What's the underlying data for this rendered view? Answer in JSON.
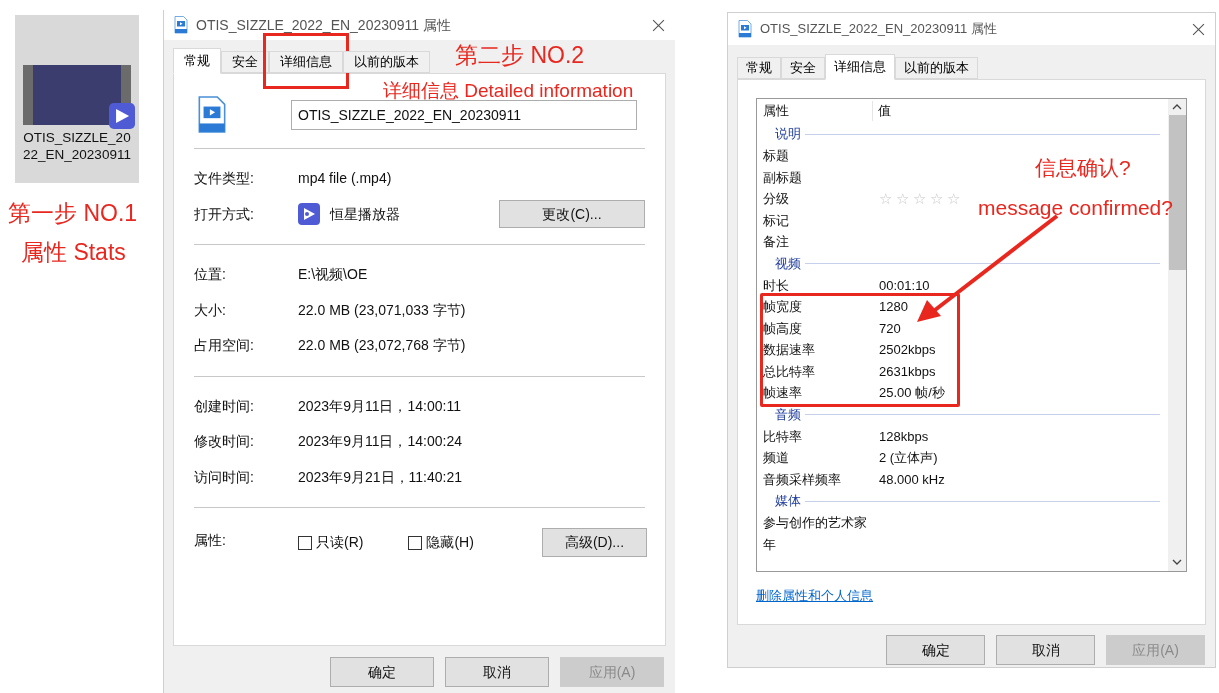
{
  "file_tile": {
    "name": "OTIS_SIZZLE_2022_EN_20230911"
  },
  "annotations": [
    {
      "text": "第一步 NO.1"
    },
    {
      "text": "属性 Stats"
    },
    {
      "text": "第二步 NO.2"
    },
    {
      "text": "详细信息 Detailed information"
    },
    {
      "text": "信息确认?"
    },
    {
      "text": "message confirmed?"
    }
  ],
  "general_dialog": {
    "title": "OTIS_SIZZLE_2022_EN_20230911 属性",
    "tabs": [
      {
        "label": "常规",
        "selected": true,
        "highlighted": false
      },
      {
        "label": "安全",
        "selected": false,
        "highlighted": false
      },
      {
        "label": "详细信息",
        "selected": false,
        "highlighted": true
      },
      {
        "label": "以前的版本",
        "selected": false,
        "highlighted": false
      }
    ],
    "filename": "OTIS_SIZZLE_2022_EN_20230911",
    "groups": [
      {
        "rows": [
          {
            "kind": "text",
            "label": "文件类型:",
            "value": "mp4 file (.mp4)"
          },
          {
            "kind": "app",
            "label": "打开方式:",
            "value": "恒星播放器",
            "button": "更改(C)..."
          }
        ]
      },
      {
        "rows": [
          {
            "kind": "text",
            "label": "位置:",
            "value": "E:\\视频\\OE"
          },
          {
            "kind": "text",
            "label": "大小:",
            "value": "22.0 MB (23,071,033 字节)"
          },
          {
            "kind": "text",
            "label": "占用空间:",
            "value": "22.0 MB (23,072,768 字节)"
          }
        ]
      },
      {
        "rows": [
          {
            "kind": "text",
            "label": "创建时间:",
            "value": "2023年9月11日，14:00:11"
          },
          {
            "kind": "text",
            "label": "修改时间:",
            "value": "2023年9月11日，14:00:24"
          },
          {
            "kind": "text",
            "label": "访问时间:",
            "value": "2023年9月21日，11:40:21"
          }
        ]
      }
    ],
    "attributes": {
      "label": "属性:",
      "checkboxes": [
        {
          "label": "只读(R)",
          "checked": false
        },
        {
          "label": "隐藏(H)",
          "checked": false
        }
      ],
      "button": "高级(D)..."
    },
    "buttons": [
      {
        "label": "确定",
        "disabled": false
      },
      {
        "label": "取消",
        "disabled": false
      },
      {
        "label": "应用(A)",
        "disabled": true
      }
    ]
  },
  "details_dialog": {
    "title": "OTIS_SIZZLE_2022_EN_20230911 属性",
    "tabs": [
      {
        "label": "常规",
        "selected": false
      },
      {
        "label": "安全",
        "selected": false
      },
      {
        "label": "详细信息",
        "selected": true
      },
      {
        "label": "以前的版本",
        "selected": false
      }
    ],
    "columns": [
      "属性",
      "值"
    ],
    "sections": [
      {
        "title": "说明",
        "rows": [
          {
            "kind": "text",
            "property": "标题",
            "highlighted": false
          },
          {
            "kind": "text",
            "property": "副标题",
            "highlighted": false
          },
          {
            "kind": "rating",
            "property": "分级",
            "stars": 0,
            "highlighted": false
          },
          {
            "kind": "text",
            "property": "标记",
            "highlighted": false
          },
          {
            "kind": "text",
            "property": "备注",
            "highlighted": false
          }
        ]
      },
      {
        "title": "视频",
        "rows": [
          {
            "kind": "text",
            "property": "时长",
            "value": "00:01:10",
            "highlighted": false
          },
          {
            "kind": "text",
            "property": "帧宽度",
            "value": "1280",
            "highlighted": true
          },
          {
            "kind": "text",
            "property": "帧高度",
            "value": "720",
            "highlighted": true
          },
          {
            "kind": "text",
            "property": "数据速率",
            "value": "2502kbps",
            "highlighted": true
          },
          {
            "kind": "text",
            "property": "总比特率",
            "value": "2631kbps",
            "highlighted": true
          },
          {
            "kind": "text",
            "property": "帧速率",
            "value": "25.00 帧/秒",
            "highlighted": true
          }
        ]
      },
      {
        "title": "音频",
        "rows": [
          {
            "kind": "text",
            "property": "比特率",
            "value": "128kbps",
            "highlighted": false
          },
          {
            "kind": "text",
            "property": "频道",
            "value": "2 (立体声)",
            "highlighted": false
          },
          {
            "kind": "text",
            "property": "音频采样频率",
            "value": "48.000 kHz",
            "highlighted": false
          }
        ]
      },
      {
        "title": "媒体",
        "rows": [
          {
            "kind": "text",
            "property": "参与创作的艺术家",
            "highlighted": false
          },
          {
            "kind": "text",
            "property": "年",
            "highlighted": false
          }
        ]
      }
    ],
    "link": "删除属性和个人信息",
    "buttons": [
      {
        "label": "确定",
        "disabled": false
      },
      {
        "label": "取消",
        "disabled": false
      },
      {
        "label": "应用(A)",
        "disabled": true
      }
    ]
  }
}
